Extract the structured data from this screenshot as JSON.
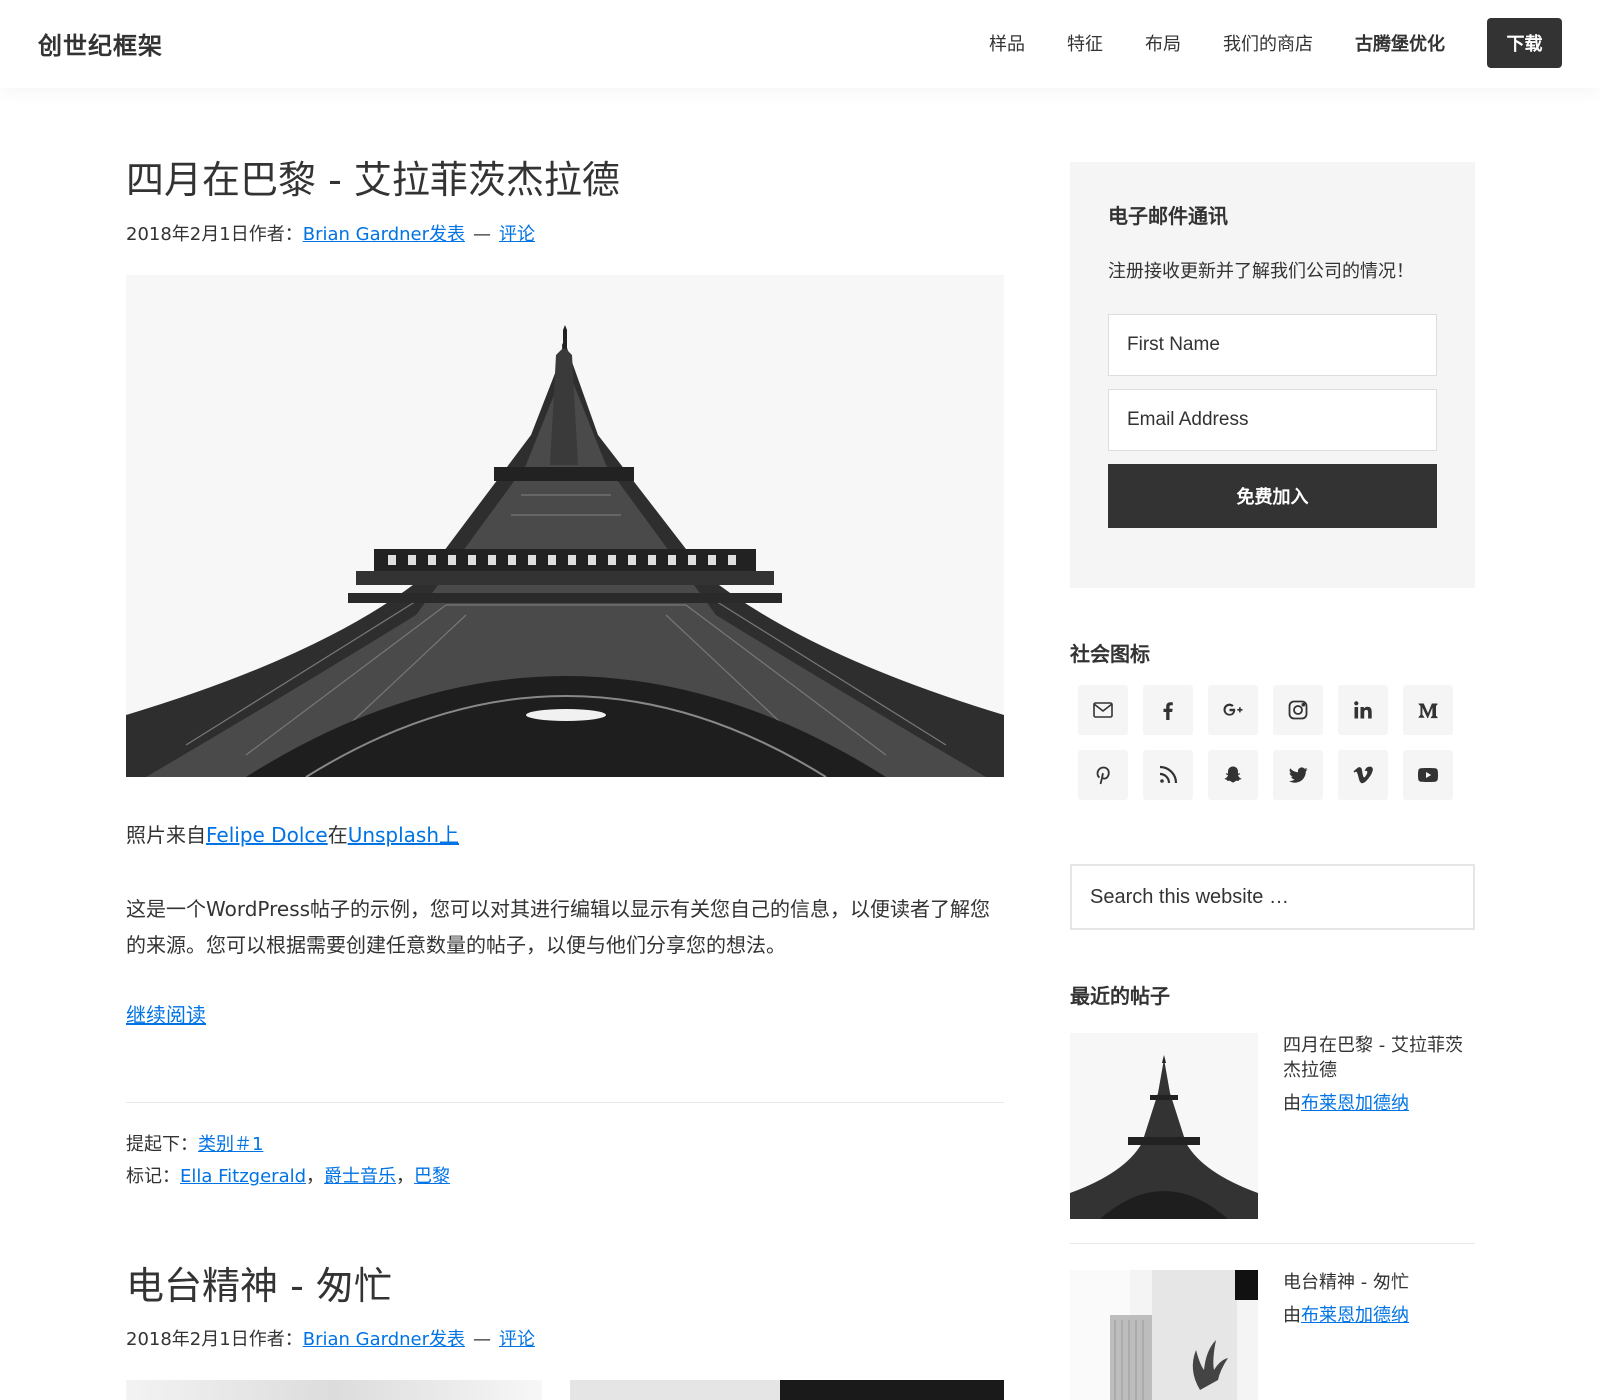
{
  "header": {
    "site_title": "创世纪框架",
    "nav": [
      "样品",
      "特征",
      "布局",
      "我们的商店"
    ],
    "nav_bold": "古腾堡优化",
    "download": "下载"
  },
  "post1": {
    "title": "四月在巴黎 - 艾拉菲茨杰拉德",
    "meta_date": "2018年2月1日作者：",
    "meta_author": "Brian Gardner发表",
    "meta_sep": "—",
    "meta_comments": "评论",
    "credit_prefix": "照片来自",
    "credit_author": "Felipe Dolce",
    "credit_mid": "在",
    "credit_site": "Unsplash上",
    "body": "这是一个WordPress帖子的示例，您可以对其进行编辑以显示有关您自己的信息，以便读者了解您的来源。您可以根据需要创建任意数量的帖子，以便与他们分享您的想法。",
    "more": "继续阅读",
    "filed_label": "提起下：",
    "filed_cat": "类别＃1",
    "tags_label": "标记：",
    "tags": [
      "Ella Fitzgerald",
      "爵士音乐",
      "巴黎"
    ],
    "tag_sep": "，"
  },
  "post2": {
    "title": "电台精神 - 匆忙",
    "meta_date": "2018年2月1日作者：",
    "meta_author": "Brian Gardner发表",
    "meta_sep": "—",
    "meta_comments": "评论"
  },
  "sidebar": {
    "newsletter_title": "电子邮件通讯",
    "newsletter_text": "注册接收更新并了解我们公司的情况！",
    "first_name_placeholder": "First Name",
    "email_placeholder": "Email Address",
    "join_button": "免费加入",
    "social_title": "社会图标",
    "social_icons": [
      "email-icon",
      "facebook-icon",
      "google-plus-icon",
      "instagram-icon",
      "linkedin-icon",
      "medium-icon",
      "pinterest-icon",
      "rss-icon",
      "snapchat-icon",
      "twitter-icon",
      "vimeo-icon",
      "youtube-icon"
    ],
    "search_placeholder": "Search this website …",
    "recent_title": "最近的帖子",
    "recent": [
      {
        "title": "四月在巴黎 - 艾拉菲茨杰拉德",
        "by": "由",
        "author": "布莱恩加德纳"
      },
      {
        "title": "电台精神 - 匆忙",
        "by": "由",
        "author": "布莱恩加德纳"
      }
    ]
  },
  "colors": {
    "link": "#0073e5",
    "dark": "#333333",
    "panel": "#f5f5f5"
  }
}
